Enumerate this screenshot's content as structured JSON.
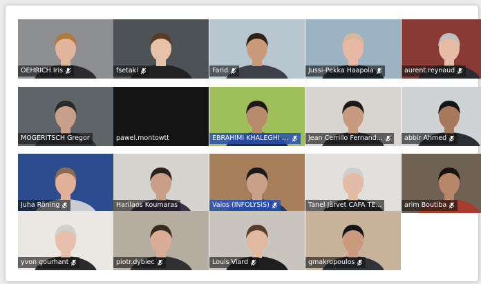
{
  "participants": [
    {
      "name": "OEHRICH Iris",
      "muted": true,
      "bg": "#8d8f93",
      "skin": "#e0b59b",
      "hair": "#b07a3e",
      "shirt": "#2b2b30"
    },
    {
      "name": "fsetaki",
      "muted": true,
      "bg": "#4d5257",
      "skin": "#e8c2a8",
      "hair": "#5b3a22",
      "shirt": "#222222"
    },
    {
      "name": "Farid",
      "muted": true,
      "bg": "#b7c6cf",
      "skin": "#c99a7a",
      "hair": "#2d2118",
      "shirt": "#3d4048"
    },
    {
      "name": "Jussi-Pekka Haapola",
      "muted": true,
      "bg": "#9bb3c2",
      "skin": "#e7b9a4",
      "hair": "#d6b79a",
      "shirt": "#1d2a39"
    },
    {
      "name": "aurent.reynaud",
      "muted": true,
      "bg": "#8a3a35",
      "skin": "#e4bda4",
      "hair": "#bfbfbf",
      "shirt": "#2a2d33"
    },
    {
      "name": "MOGERITSCH Gregor",
      "muted": false,
      "bg": "#5f6469",
      "skin": "#c8a08a",
      "hair": "#2a2a2a",
      "shirt": "#303338"
    },
    {
      "name": "pawel.montowtt",
      "muted": false,
      "bg": "#141414",
      "skin": null,
      "hair": null,
      "shirt": null
    },
    {
      "name": "EBRAHIMI KHALEGHI E...",
      "muted": true,
      "bg": "#9fbf5a",
      "skin": "#b88a6e",
      "hair": "#1f1a16",
      "shirt": "#1f2a3a",
      "highlight": true
    },
    {
      "name": "Jean Cerrillo Fernand...",
      "muted": true,
      "bg": "#d8d4cf",
      "skin": "#c79a80",
      "hair": "#1a1a1a",
      "shirt": "#2f3136"
    },
    {
      "name": "abbir Ahmed",
      "muted": true,
      "bg": "#cfd3d6",
      "skin": "#a7785c",
      "hair": "#141414",
      "shirt": "#2b2e33"
    },
    {
      "name": "Juha Röning",
      "muted": true,
      "bg": "#2c4c8f",
      "skin": "#e0b098",
      "hair": "#8a6a52",
      "shirt": "#c9ccd1"
    },
    {
      "name": "Harilaos Koumaras",
      "muted": false,
      "bg": "#d6d3cf",
      "skin": "#c99e86",
      "hair": "#2a221c",
      "shirt": "#3a2f4a"
    },
    {
      "name": "Vaios (INFOLYSiS)",
      "muted": true,
      "bg": "#a77e5a",
      "skin": "#c9a088",
      "hair": "#1a1a1a",
      "shirt": "#1f3a66",
      "highlight": true
    },
    {
      "name": "Tanel Järvet CAFA TE...",
      "muted": false,
      "bg": "#e2e0dc",
      "skin": "#e2bca6",
      "hair": "#cfcfcf",
      "shirt": "#2a2c31"
    },
    {
      "name": "arim Boutiba",
      "muted": true,
      "bg": "#6f6253",
      "skin": "#b8866a",
      "hair": "#1a1410",
      "shirt": "#a83a2e"
    },
    {
      "name": "yvon gourhant",
      "muted": true,
      "bg": "#ebe7e2",
      "skin": "#e6c0ac",
      "hair": "#d0d0d0",
      "shirt": "#2a2a2a"
    },
    {
      "name": "piotr.dybiec",
      "muted": true,
      "bg": "#b5ad9f",
      "skin": "#d9ad96",
      "hair": "#3a2a1e",
      "shirt": "#2f3135"
    },
    {
      "name": "Louis Viard",
      "muted": true,
      "bg": "#c9c4be",
      "skin": "#e1b8a0",
      "hair": "#5a3d28",
      "shirt": "#1f1f22"
    },
    {
      "name": "gmakropoulos",
      "muted": true,
      "bg": "#c8b39a",
      "skin": "#c99a7e",
      "hair": "#141414",
      "shirt": "#30333a"
    }
  ],
  "colors": {
    "label_bg": "#232323",
    "label_text": "#ffffff",
    "mic_muted": "#ffffff"
  },
  "icons": {
    "mic": "microphone-muted-icon"
  }
}
